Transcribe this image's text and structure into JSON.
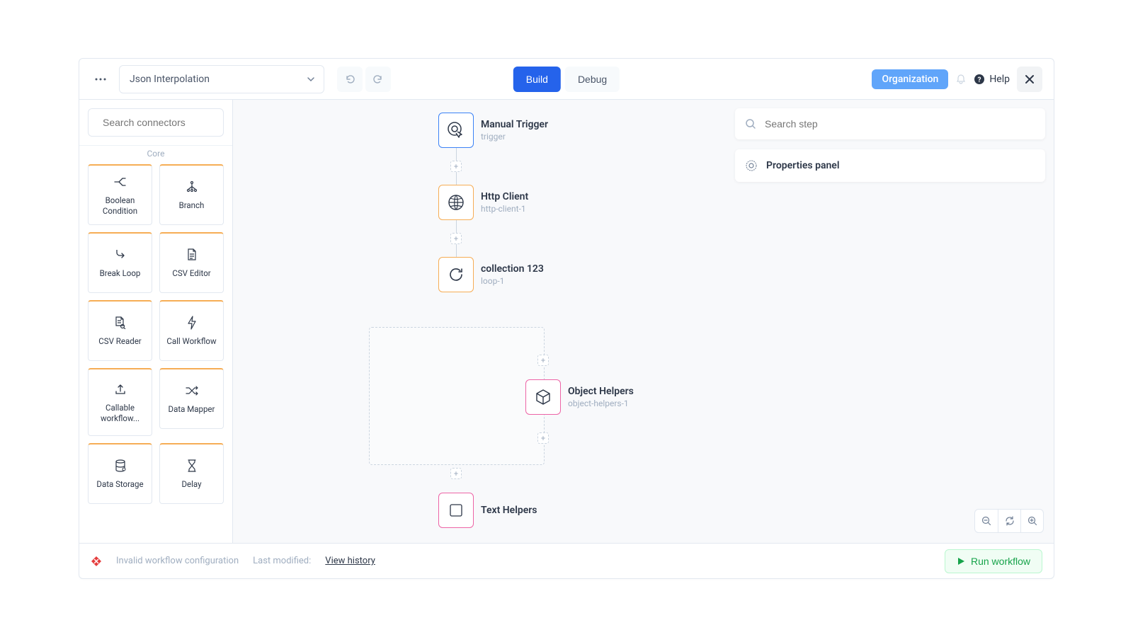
{
  "topbar": {
    "workflow_name": "Json Interpolation",
    "mode_build": "Build",
    "mode_debug": "Debug",
    "org_label": "Organization",
    "help_label": "Help"
  },
  "sidebar": {
    "search_placeholder": "Search connectors",
    "section_label": "Core",
    "connectors": [
      {
        "label": "Boolean Condition",
        "icon": "branch-arrow"
      },
      {
        "label": "Branch",
        "icon": "tree"
      },
      {
        "label": "Break Loop",
        "icon": "return"
      },
      {
        "label": "CSV Editor",
        "icon": "doc-edit"
      },
      {
        "label": "CSV Reader",
        "icon": "doc-search"
      },
      {
        "label": "Call Workflow",
        "icon": "bolt"
      },
      {
        "label": "Callable workflow...",
        "icon": "upload"
      },
      {
        "label": "Data Mapper",
        "icon": "shuffle"
      },
      {
        "label": "Data Storage",
        "icon": "database"
      },
      {
        "label": "Delay",
        "icon": "hourglass"
      }
    ]
  },
  "canvas": {
    "nodes": [
      {
        "title": "Manual Trigger",
        "sub": "trigger",
        "border": "blue",
        "icon": "target"
      },
      {
        "title": "Http Client",
        "sub": "http-client-1",
        "border": "orange",
        "icon": "globe"
      },
      {
        "title": "collection 123",
        "sub": "loop-1",
        "border": "orange",
        "icon": "loop"
      }
    ],
    "obj_node": {
      "title": "Object Helpers",
      "sub": "object-helpers-1",
      "border": "pink",
      "icon": "cube"
    },
    "next_node": {
      "title": "Text Helpers",
      "sub": "",
      "border": "pink",
      "icon": "text"
    }
  },
  "right": {
    "search_placeholder": "Search step",
    "props_title": "Properties panel"
  },
  "footer": {
    "error_text": "Invalid workflow configuration",
    "modified_label": "Last modified:",
    "history_link": "View history",
    "run_label": "Run workflow"
  }
}
